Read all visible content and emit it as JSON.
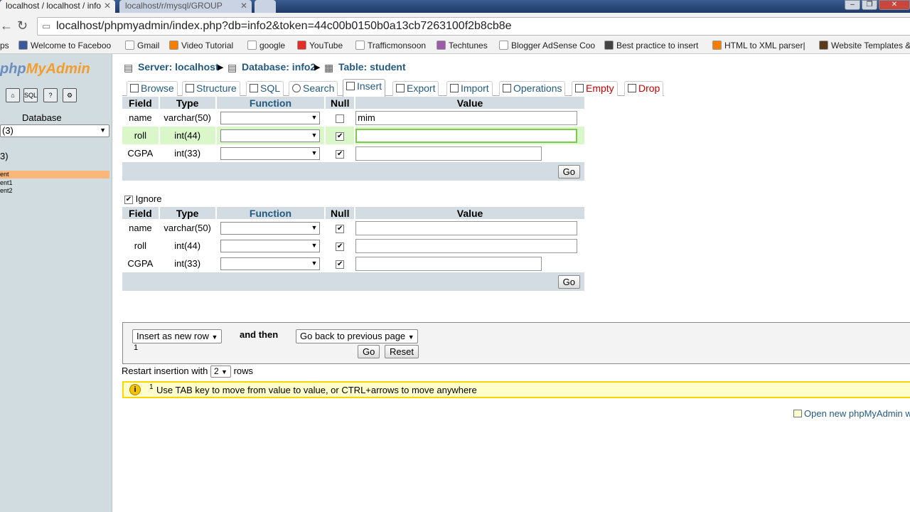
{
  "browser": {
    "tabs": [
      {
        "title": "localhost / localhost / info",
        "close": "✕"
      },
      {
        "title": "localhost/r/mysql/GROUP",
        "close": "✕"
      }
    ],
    "url": "localhost/phpmyadmin/index.php?db=info2&token=44c00b0150b0a13cb7263100f2b8cb8e",
    "bookmarks": [
      {
        "label": "ps",
        "color": "#ffffff"
      },
      {
        "label": "Welcome to Faceboo",
        "color": "#3b5998"
      },
      {
        "label": "Gmail",
        "color": "#ffffff"
      },
      {
        "label": "Video Tutorial",
        "color": "#f57d00"
      },
      {
        "label": "google",
        "color": "#ffffff"
      },
      {
        "label": "YouTube",
        "color": "#e52d27"
      },
      {
        "label": "Trafficmonsoon",
        "color": "#ffffff"
      },
      {
        "label": "Techtunes",
        "color": "#9c5ca8"
      },
      {
        "label": "Blogger AdSense Coo",
        "color": "#ffffff"
      },
      {
        "label": "Best practice to insert",
        "color": "#444444"
      },
      {
        "label": "HTML to XML parser|",
        "color": "#f57d00"
      },
      {
        "label": "Website Templates &",
        "color": "#5a3a1a"
      }
    ]
  },
  "leftnav": {
    "logo_a": "php",
    "logo_b": "MyAdmin",
    "icons": [
      "home-icon",
      "sql-icon",
      "docs-icon",
      "settings-icon"
    ],
    "icon_glyphs": [
      "⌂",
      "SQL",
      "?",
      "⚙"
    ],
    "database_label": "Database",
    "database_select": "(3)",
    "db_heading": "3)",
    "tables": [
      "ent",
      "ent1",
      "ent2"
    ]
  },
  "breadcrumb": {
    "server": "Server: localhost",
    "database": "Database: info2",
    "table": "Table: student"
  },
  "tabs": [
    {
      "label": "Browse"
    },
    {
      "label": "Structure"
    },
    {
      "label": "SQL"
    },
    {
      "label": "Search"
    },
    {
      "label": "Insert"
    },
    {
      "label": "Export"
    },
    {
      "label": "Import"
    },
    {
      "label": "Operations"
    },
    {
      "label": "Empty"
    },
    {
      "label": "Drop"
    }
  ],
  "table_headers": {
    "field": "Field",
    "type": "Type",
    "function": "Function",
    "null": "Null",
    "value": "Value"
  },
  "form1": {
    "rows": [
      {
        "field": "name",
        "type": "varchar(50)",
        "null_checked": false,
        "value": "mim"
      },
      {
        "field": "roll",
        "type": "int(44)",
        "null_checked": true,
        "value": ""
      },
      {
        "field": "CGPA",
        "type": "int(33)",
        "null_checked": true,
        "value": ""
      }
    ],
    "go": "Go"
  },
  "ignore": {
    "label": "Ignore",
    "checked": true
  },
  "form2": {
    "rows": [
      {
        "field": "name",
        "type": "varchar(50)",
        "null_checked": true,
        "value": ""
      },
      {
        "field": "roll",
        "type": "int(44)",
        "null_checked": true,
        "value": ""
      },
      {
        "field": "CGPA",
        "type": "int(33)",
        "null_checked": true,
        "value": ""
      }
    ],
    "go": "Go"
  },
  "controls": {
    "insert_mode": "Insert as new row",
    "and_then": "and then",
    "after_action": "Go back to previous page",
    "footnote_marker": "1",
    "go": "Go",
    "reset": "Reset"
  },
  "restart": {
    "prefix": "Restart insertion with",
    "count": "2",
    "suffix": "rows"
  },
  "notice": {
    "sup": "1",
    "text": "Use TAB key to move from value to value, or CTRL+arrows to move anywhere"
  },
  "open_new": "Open new phpMyAdmin w"
}
